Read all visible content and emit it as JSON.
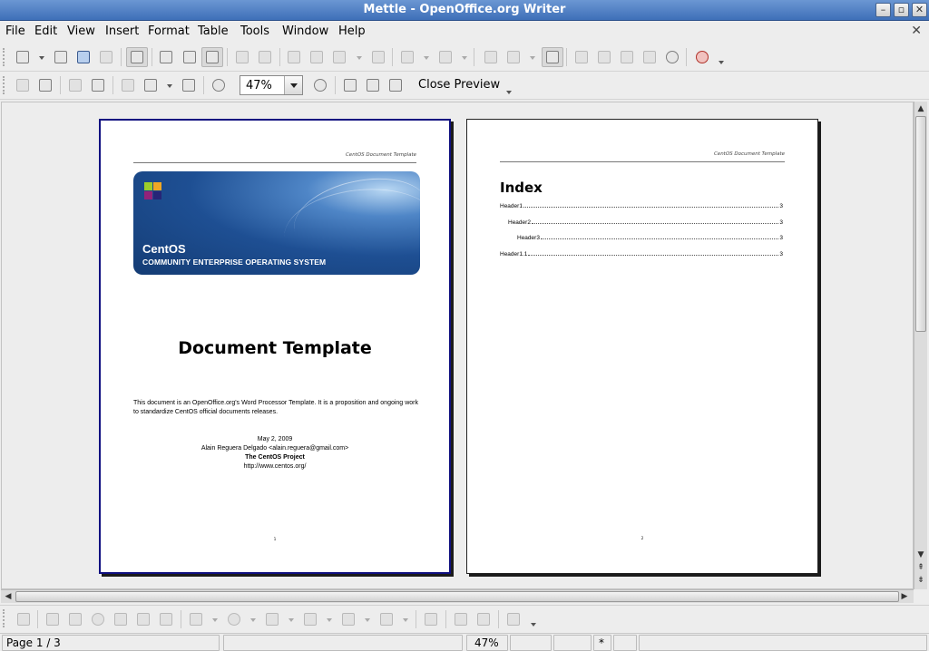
{
  "window": {
    "title": "Mettle - OpenOffice.org Writer"
  },
  "menu": [
    "File",
    "Edit",
    "View",
    "Insert",
    "Format",
    "Table",
    "Tools",
    "Window",
    "Help"
  ],
  "preview_toolbar": {
    "zoom_value": "47%",
    "close_preview_label": "Close Preview"
  },
  "page1": {
    "header_text": "CentOS Document Template",
    "banner_name": "CentOS",
    "banner_tagline": "COMMUNITY ENTERPRISE OPERATING SYSTEM",
    "title": "Document Template",
    "description": "This document is an OpenOffice.org's Word Processor Template. It is a proposition and ongoing work to standardize CentOS official documents releases.",
    "date": "May 2, 2009",
    "author": "Alain Reguera Delgado <alain.reguera@gmail.com>",
    "project": "The CentOS Project",
    "url": "http://www.centos.org/",
    "page_number": "1"
  },
  "page2": {
    "header_text": "CentOS Document Template",
    "index_title": "Index",
    "toc": [
      {
        "label": "Header1",
        "page": "3"
      },
      {
        "label": "Header2",
        "page": "3"
      },
      {
        "label": "Header3",
        "page": "3"
      },
      {
        "label": "Header1.1",
        "page": "3"
      }
    ],
    "page_number": "2"
  },
  "status": {
    "page_info": "Page 1 / 3",
    "zoom": "47%",
    "modified": "*"
  },
  "colors": {
    "titlebar": "#4f7fc4",
    "page_selected_border": "#101080",
    "banner": "#1e4f93"
  }
}
